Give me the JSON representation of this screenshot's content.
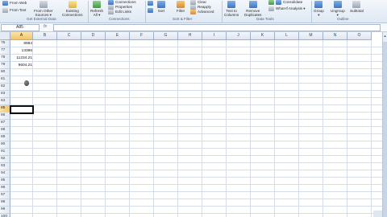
{
  "ribbon": {
    "get_external": {
      "items": [
        "From Web",
        "From Text"
      ],
      "other_sources": "From Other\nSources ▾",
      "existing": "Existing\nConnections",
      "label": "Get External Data"
    },
    "connections": {
      "refresh": "Refresh\nAll ▾",
      "items": [
        "Connections",
        "Properties",
        "Edit Links"
      ],
      "label": "Connections"
    },
    "sort_filter": {
      "sort": "Sort",
      "filter": "Filter",
      "items": [
        "Clear",
        "Reapply",
        "Advanced"
      ],
      "label": "Sort & Filter"
    },
    "data_tools": {
      "text_to_columns": "Text to\nColumns",
      "remove_duplicates": "Remove\nDuplicates",
      "items": [
        "Consolidate",
        "What-If Analysis ▾"
      ],
      "label": "Data Tools"
    },
    "outline": {
      "group": "Group\n▾",
      "ungroup": "Ungroup\n▾",
      "subtotal": "Subtotal",
      "label": "Outline"
    }
  },
  "formula_bar": {
    "name_box": "A85",
    "fx": "fx",
    "formula": ""
  },
  "columns": [
    "A",
    "B",
    "C",
    "D",
    "E",
    "F",
    "G",
    "H",
    "I",
    "J",
    "K",
    "L",
    "M",
    "N",
    "O"
  ],
  "selected_column": "A",
  "rows": [
    "76",
    "77",
    "78",
    "79",
    "80",
    "81",
    "82",
    "83",
    "84",
    "85",
    "86",
    "87",
    "88",
    "89",
    "90",
    "91",
    "92",
    "93",
    "94",
    "95",
    "96",
    "97",
    "98",
    "99",
    "100"
  ],
  "selected_row": "85",
  "cells": [
    {
      "row": "76",
      "value": "8984"
    },
    {
      "row": "77",
      "value": "13386"
    },
    {
      "row": "78",
      "value": "11234.21"
    },
    {
      "row": "79",
      "value": "9604.21"
    }
  ]
}
